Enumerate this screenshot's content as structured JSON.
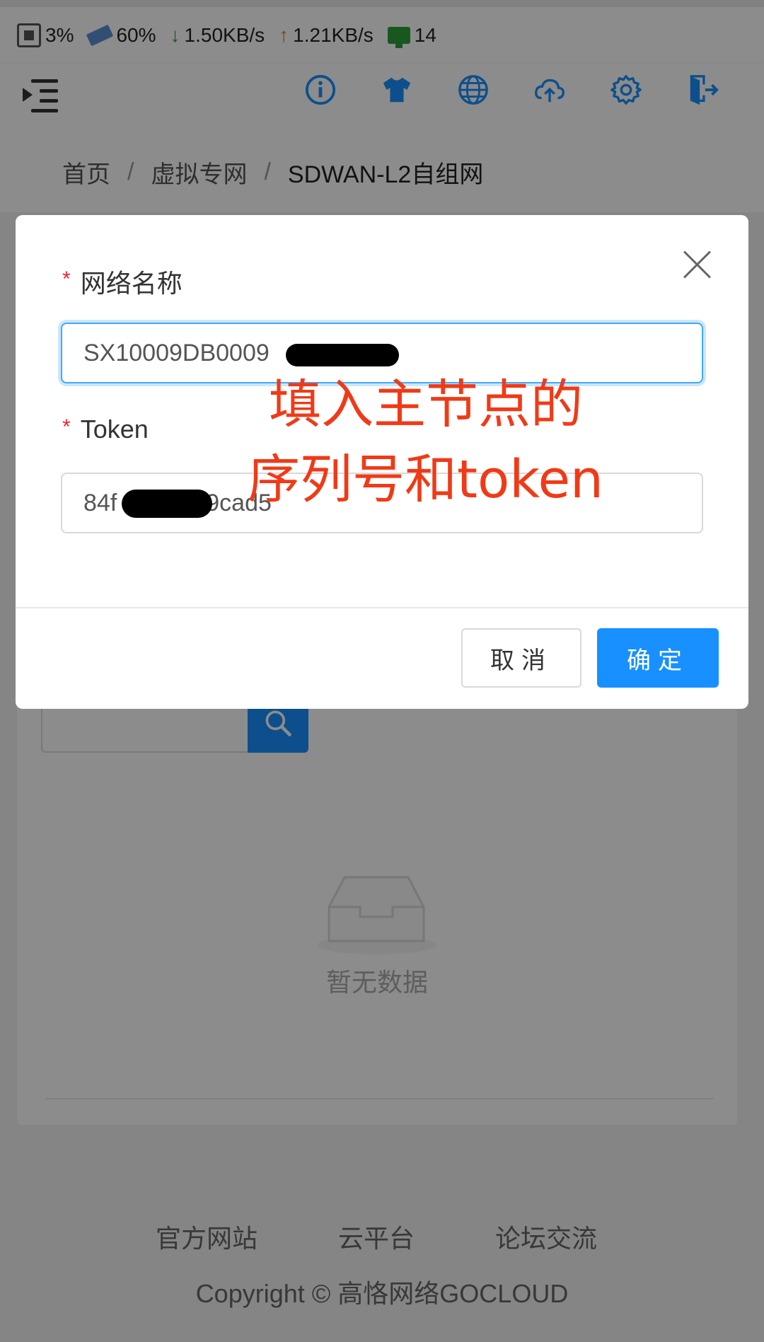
{
  "status_bar": {
    "cpu": "3%",
    "ram": "60%",
    "download": "1.50KB/s",
    "upload": "1.21KB/s",
    "devices": "14",
    "colors": {
      "down": "#2e9e3b",
      "up": "#e07a1a",
      "devices": "#2e9e3b"
    }
  },
  "header": {
    "icons": [
      "menu-icon",
      "info-icon",
      "tshirt-icon",
      "globe-icon",
      "cloud-upload-icon",
      "gear-icon",
      "logout-icon"
    ],
    "accent": "#1890ff"
  },
  "breadcrumb": {
    "items": [
      "首页",
      "虚拟专网",
      "SDWAN-L2自组网"
    ],
    "separator": "/"
  },
  "background": {
    "empty_text": "暂无数据"
  },
  "footer": {
    "links": [
      "官方网站",
      "云平台",
      "论坛交流"
    ],
    "copyright": "Copyright © 高恪网络GOCLOUD"
  },
  "modal": {
    "fields": [
      {
        "label": "网络名称",
        "required_mark": "*",
        "value": "SX10009DB0009"
      },
      {
        "label": "Token",
        "required_mark": "*",
        "value": "84f",
        "value_suffix": "9cad5"
      }
    ],
    "cancel_label": "取消",
    "ok_label": "确定"
  },
  "annotation": {
    "line1": "填入主节点的",
    "line2": "序列号和token",
    "color": "#f03a17"
  }
}
